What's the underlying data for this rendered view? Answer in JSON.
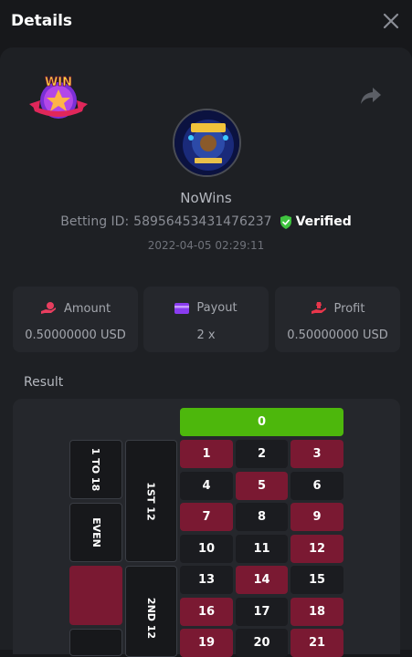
{
  "header": {
    "title": "Details",
    "close_icon": "close-icon"
  },
  "profile": {
    "badge_text": "WIN",
    "username": "NoWins",
    "betting_id_label": "Betting ID:",
    "betting_id_value": "58956453431476237",
    "verified_label": "Verified",
    "timestamp": "2022-04-05 02:29:11"
  },
  "cards": [
    {
      "label": "Amount",
      "value": "0.50000000 USD",
      "icon": "coin-hand-icon",
      "color": "#e83e5f"
    },
    {
      "label": "Payout",
      "value": "2 x",
      "icon": "wallet-card-icon",
      "color": "#8a3cf0"
    },
    {
      "label": "Profit",
      "value": "0.50000000 USD",
      "icon": "profit-hand-icon",
      "color": "#e8364b"
    }
  ],
  "result": {
    "label": "Result",
    "zero": "0",
    "outside": [
      "1 TO 18",
      "EVEN",
      "1ST 12",
      "2ND 12"
    ],
    "rows": [
      [
        {
          "n": "1",
          "c": "red"
        },
        {
          "n": "2",
          "c": "black"
        },
        {
          "n": "3",
          "c": "red"
        }
      ],
      [
        {
          "n": "4",
          "c": "black"
        },
        {
          "n": "5",
          "c": "red"
        },
        {
          "n": "6",
          "c": "black"
        }
      ],
      [
        {
          "n": "7",
          "c": "red"
        },
        {
          "n": "8",
          "c": "black"
        },
        {
          "n": "9",
          "c": "red"
        }
      ],
      [
        {
          "n": "10",
          "c": "black"
        },
        {
          "n": "11",
          "c": "black"
        },
        {
          "n": "12",
          "c": "red"
        }
      ],
      [
        {
          "n": "13",
          "c": "black"
        },
        {
          "n": "14",
          "c": "red"
        },
        {
          "n": "15",
          "c": "black"
        }
      ],
      [
        {
          "n": "16",
          "c": "red"
        },
        {
          "n": "17",
          "c": "black"
        },
        {
          "n": "18",
          "c": "red"
        }
      ],
      [
        {
          "n": "19",
          "c": "red"
        },
        {
          "n": "20",
          "c": "black"
        },
        {
          "n": "21",
          "c": "red"
        }
      ]
    ]
  },
  "colors": {
    "background": "#17181b",
    "panel": "#1e2024",
    "card": "#25272c",
    "red": "#7a1932",
    "green": "#4db70c",
    "verified": "#3fc33f"
  }
}
